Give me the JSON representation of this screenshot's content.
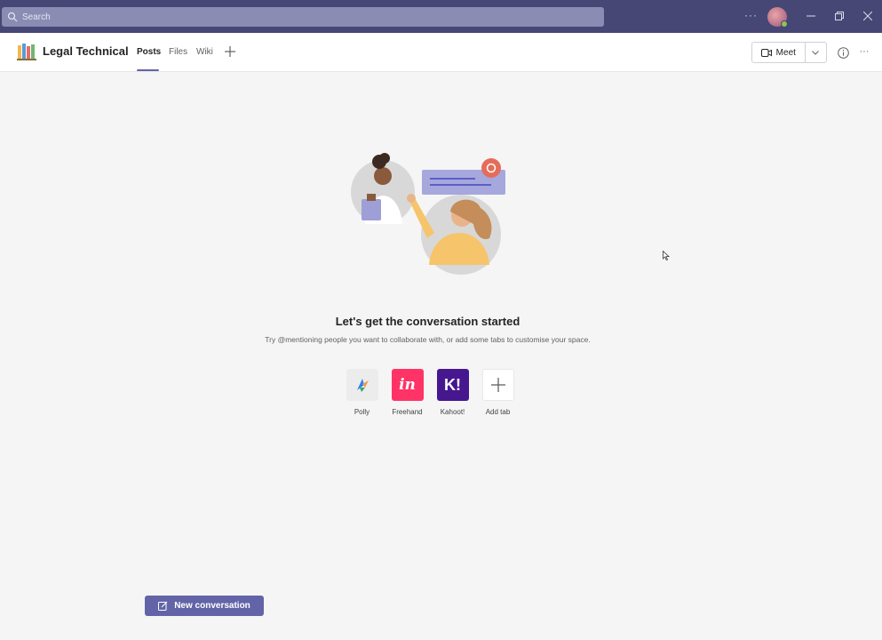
{
  "titlebar": {
    "search_placeholder": "Search",
    "more_label": "···"
  },
  "header": {
    "team_name": "Legal Technical",
    "tabs": [
      {
        "label": "Posts",
        "active": true
      },
      {
        "label": "Files",
        "active": false
      },
      {
        "label": "Wiki",
        "active": false
      }
    ],
    "meet_label": "Meet",
    "more_label": "···"
  },
  "empty_state": {
    "title": "Let's get the conversation started",
    "subtitle": "Try @mentioning people you want to collaborate with, or add some tabs to customise your space."
  },
  "apps": [
    {
      "label": "Polly",
      "icon": "polly-icon"
    },
    {
      "label": "Freehand",
      "icon": "freehand-icon",
      "glyph": "in"
    },
    {
      "label": "Kahoot!",
      "icon": "kahoot-icon",
      "glyph": "K!"
    },
    {
      "label": "Add tab",
      "icon": "plus-icon"
    }
  ],
  "compose": {
    "new_conversation_label": "New conversation"
  },
  "colors": {
    "brand": "#6264a7",
    "titlebar": "#464775",
    "freehand": "#ff3366",
    "kahoot": "#46178f"
  }
}
